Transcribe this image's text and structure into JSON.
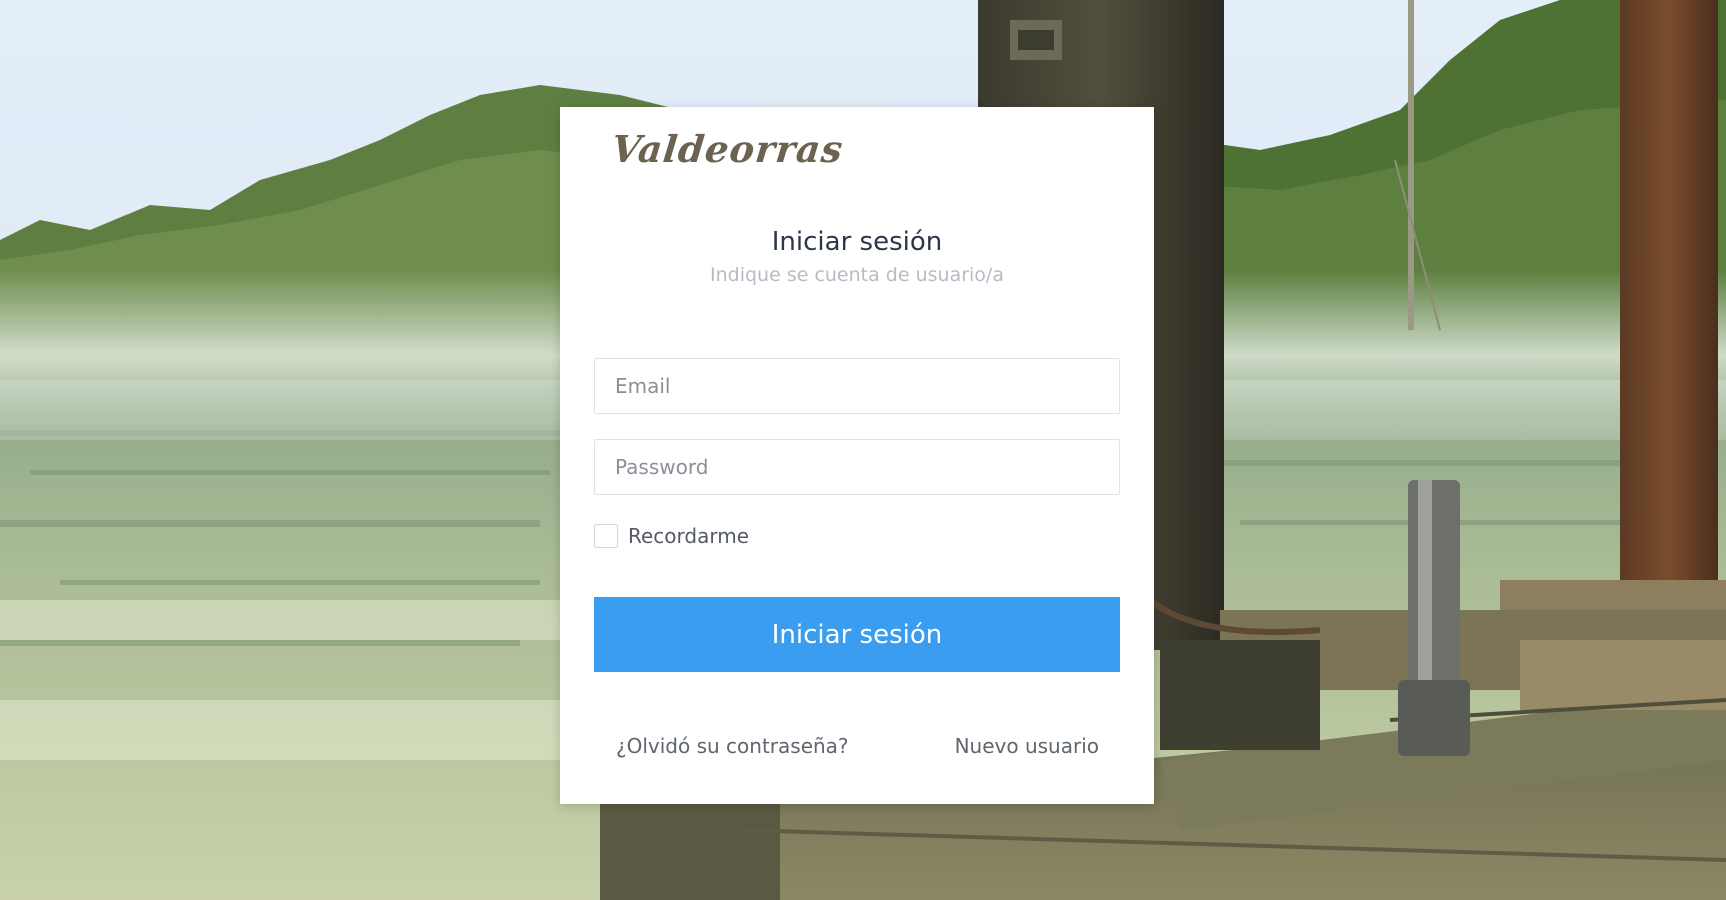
{
  "brand": {
    "logo_text": "Valdeorras"
  },
  "login": {
    "title": "Iniciar sesión",
    "subtitle": "Indique se cuenta de usuario/a",
    "email_placeholder": "Email",
    "password_placeholder": "Password",
    "remember_label": "Recordarme",
    "submit_label": "Iniciar sesión",
    "forgot_label": "¿Olvidó su contraseña?",
    "new_user_label": "Nuevo usuario"
  },
  "colors": {
    "primary_button": "#3a9df0",
    "card_background": "#ffffff",
    "title_text": "#2d3748",
    "subtitle_text": "#b7bcc4",
    "link_text": "#5f666e",
    "logo_text": "#6b6250"
  }
}
